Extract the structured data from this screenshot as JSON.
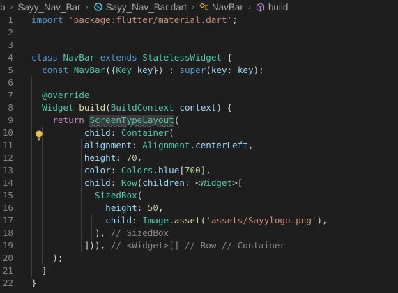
{
  "breadcrumb": {
    "items": [
      {
        "label": "b",
        "icon": ""
      },
      {
        "label": "Sayy_Nav_Bar",
        "icon": ""
      },
      {
        "label": "Sayy_Nav_Bar.dart",
        "icon": "dart-icon"
      },
      {
        "label": "NavBar",
        "icon": "class-icon"
      },
      {
        "label": "build",
        "icon": "method-cube-icon"
      }
    ],
    "separator": "›"
  },
  "colors": {
    "background": "#1e1e1e",
    "line_number": "#858585",
    "keyword": "#569cd6",
    "control": "#c586c0",
    "string": "#ce9178",
    "type": "#4ec9b0",
    "function": "#dcdcaa",
    "variable": "#9cdcfe",
    "number": "#b5cea8",
    "hint": "#8b8b8b",
    "lightbulb": "#e8c14a"
  },
  "gutter": {
    "lightbulb_icon": "lightbulb-icon",
    "lightbulb_line": 9
  },
  "editor": {
    "lines": [
      {
        "n": "1",
        "tokens": [
          [
            "kw",
            "import"
          ],
          [
            "plain",
            " "
          ],
          [
            "str",
            "'package:flutter/material.dart'"
          ],
          [
            "plain",
            ";"
          ]
        ]
      },
      {
        "n": "2",
        "tokens": []
      },
      {
        "n": "3",
        "tokens": []
      },
      {
        "n": "4",
        "tokens": [
          [
            "kw",
            "class"
          ],
          [
            "plain",
            " "
          ],
          [
            "type",
            "NavBar"
          ],
          [
            "plain",
            " "
          ],
          [
            "kw",
            "extends"
          ],
          [
            "plain",
            " "
          ],
          [
            "type",
            "StatelessWidget"
          ],
          [
            "plain",
            " {"
          ]
        ]
      },
      {
        "n": "5",
        "tokens": [
          [
            "plain",
            "  "
          ],
          [
            "kw",
            "const"
          ],
          [
            "plain",
            " "
          ],
          [
            "type",
            "NavBar"
          ],
          [
            "plain",
            "({"
          ],
          [
            "type",
            "Key"
          ],
          [
            "plain",
            " "
          ],
          [
            "var",
            "key"
          ],
          [
            "plain",
            "}) : "
          ],
          [
            "kw",
            "super"
          ],
          [
            "plain",
            "("
          ],
          [
            "var",
            "key"
          ],
          [
            "plain",
            ": "
          ],
          [
            "var",
            "key"
          ],
          [
            "plain",
            ");"
          ]
        ]
      },
      {
        "n": "6",
        "tokens": []
      },
      {
        "n": "7",
        "tokens": [
          [
            "plain",
            "  "
          ],
          [
            "type",
            "@override"
          ]
        ]
      },
      {
        "n": "8",
        "tokens": [
          [
            "plain",
            "  "
          ],
          [
            "type",
            "Widget"
          ],
          [
            "plain",
            " "
          ],
          [
            "fn",
            "build"
          ],
          [
            "plain",
            "("
          ],
          [
            "type",
            "BuildContext"
          ],
          [
            "plain",
            " "
          ],
          [
            "var",
            "context"
          ],
          [
            "plain",
            ") {"
          ]
        ]
      },
      {
        "n": "9",
        "tokens": [
          [
            "plain",
            "    "
          ],
          [
            "ctl",
            "return"
          ],
          [
            "plain",
            " "
          ],
          [
            "hl",
            "ScreenTypeLayout"
          ],
          [
            "plain",
            "("
          ]
        ]
      },
      {
        "n": "10",
        "tokens": [
          [
            "plain",
            "          "
          ],
          [
            "var",
            "child"
          ],
          [
            "plain",
            ": "
          ],
          [
            "type",
            "Container"
          ],
          [
            "plain",
            "("
          ]
        ]
      },
      {
        "n": "11",
        "tokens": [
          [
            "plain",
            "          "
          ],
          [
            "var",
            "alignment"
          ],
          [
            "plain",
            ": "
          ],
          [
            "type",
            "Alignment"
          ],
          [
            "plain",
            "."
          ],
          [
            "var",
            "centerLeft"
          ],
          [
            "plain",
            ","
          ]
        ]
      },
      {
        "n": "12",
        "tokens": [
          [
            "plain",
            "          "
          ],
          [
            "var",
            "height"
          ],
          [
            "plain",
            ": "
          ],
          [
            "num",
            "70"
          ],
          [
            "plain",
            ","
          ]
        ]
      },
      {
        "n": "13",
        "tokens": [
          [
            "plain",
            "          "
          ],
          [
            "var",
            "color"
          ],
          [
            "plain",
            ": "
          ],
          [
            "type",
            "Colors"
          ],
          [
            "plain",
            "."
          ],
          [
            "var",
            "blue"
          ],
          [
            "plain",
            "["
          ],
          [
            "num",
            "700"
          ],
          [
            "plain",
            "],"
          ]
        ]
      },
      {
        "n": "14",
        "tokens": [
          [
            "plain",
            "          "
          ],
          [
            "var",
            "child"
          ],
          [
            "plain",
            ": "
          ],
          [
            "type",
            "Row"
          ],
          [
            "plain",
            "("
          ],
          [
            "var",
            "children"
          ],
          [
            "plain",
            ": <"
          ],
          [
            "type",
            "Widget"
          ],
          [
            "plain",
            ">["
          ]
        ]
      },
      {
        "n": "15",
        "tokens": [
          [
            "plain",
            "            "
          ],
          [
            "type",
            "SizedBox"
          ],
          [
            "plain",
            "("
          ]
        ]
      },
      {
        "n": "16",
        "tokens": [
          [
            "plain",
            "              "
          ],
          [
            "var",
            "height"
          ],
          [
            "plain",
            ": "
          ],
          [
            "num",
            "50"
          ],
          [
            "plain",
            ","
          ]
        ]
      },
      {
        "n": "17",
        "tokens": [
          [
            "plain",
            "              "
          ],
          [
            "var",
            "child"
          ],
          [
            "plain",
            ": "
          ],
          [
            "type",
            "Image"
          ],
          [
            "plain",
            "."
          ],
          [
            "fn",
            "asset"
          ],
          [
            "plain",
            "("
          ],
          [
            "str",
            "'assets/Sayylogo.png'"
          ],
          [
            "plain",
            "),"
          ]
        ]
      },
      {
        "n": "18",
        "tokens": [
          [
            "plain",
            "            ), "
          ],
          [
            "hint",
            "// SizedBox"
          ]
        ]
      },
      {
        "n": "19",
        "tokens": [
          [
            "plain",
            "          ])), "
          ],
          [
            "hint",
            "// <Widget>[] // Row // Container"
          ]
        ]
      },
      {
        "n": "20",
        "tokens": [
          [
            "plain",
            "    );"
          ]
        ]
      },
      {
        "n": "21",
        "tokens": [
          [
            "plain",
            "  }"
          ]
        ]
      },
      {
        "n": "22",
        "tokens": [
          [
            "plain",
            "}"
          ]
        ]
      }
    ]
  }
}
